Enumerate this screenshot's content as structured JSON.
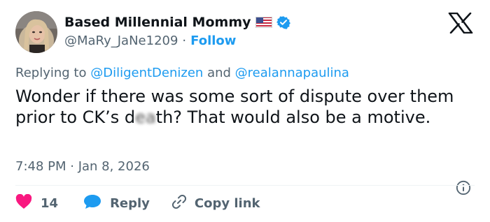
{
  "author": {
    "display_name": "Based Millennial Mommy",
    "handle": "@MaRy_JaNe1209",
    "separator": "·",
    "follow_label": "Follow"
  },
  "reply_context": {
    "prefix": "Replying to",
    "mention1": "@DiligentDenizen",
    "conjunction": "and",
    "mention2": "@realannapaulina"
  },
  "tweet": {
    "text_part1": "Wonder if there was some sort of dispute over them prior to CK’s d",
    "text_blurred": "ea",
    "text_part2": "th? That would also be a motive."
  },
  "timestamp": "7:48 PM · Jan 8, 2026",
  "actions": {
    "like_count": "14",
    "reply_label": "Reply",
    "copy_label": "Copy link"
  },
  "colors": {
    "accent": "#1d9bf0",
    "like": "#f91880",
    "secondary_text": "#536471",
    "primary_text": "#0f1419"
  },
  "icons": [
    "flag-icon",
    "verified-icon",
    "x-logo-icon",
    "info-icon",
    "heart-icon",
    "reply-bubble-icon",
    "link-icon"
  ]
}
